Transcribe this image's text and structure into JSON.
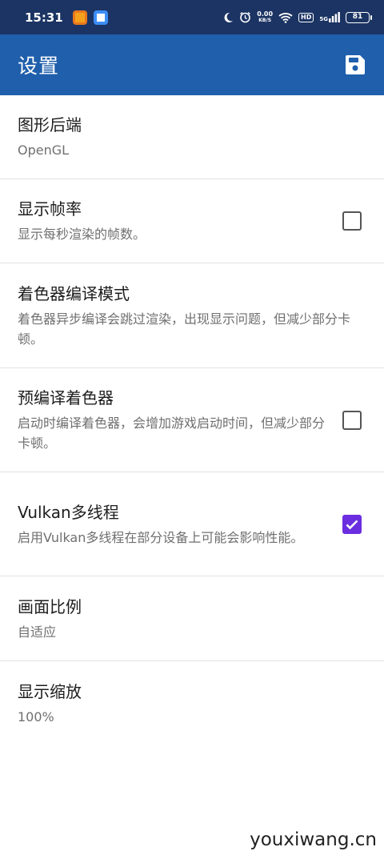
{
  "status_bar": {
    "time": "15:31",
    "net_speed_value": "0.00",
    "net_speed_unit": "KB/S",
    "hd_label": "HD",
    "signal_label": "5G",
    "battery": "81"
  },
  "app_bar": {
    "title": "设置",
    "save_icon": "save-icon"
  },
  "preferences": [
    {
      "title": "图形后端",
      "summary": "OpenGL",
      "type": "list"
    },
    {
      "title": "显示帧率",
      "summary": "显示每秒渲染的帧数。",
      "type": "checkbox",
      "checked": false
    },
    {
      "title": "着色器编译模式",
      "summary": "着色器异步编译会跳过渲染，出现显示问题，但减少部分卡顿。",
      "type": "list"
    },
    {
      "title": "预编译着色器",
      "summary": "启动时编译着色器，会增加游戏启动时间，但减少部分卡顿。",
      "type": "checkbox",
      "checked": false
    },
    {
      "title": "Vulkan多线程",
      "summary": "启用Vulkan多线程在部分设备上可能会影响性能。",
      "type": "checkbox",
      "checked": true
    },
    {
      "title": "画面比例",
      "summary": "自适应",
      "type": "list"
    },
    {
      "title": "显示缩放",
      "summary": "100%",
      "type": "list"
    }
  ],
  "watermark": "youxiwang.cn",
  "colors": {
    "status_bar": "#1b3463",
    "app_bar": "#1f5fab",
    "checkbox_checked": "#6a2ee0"
  }
}
